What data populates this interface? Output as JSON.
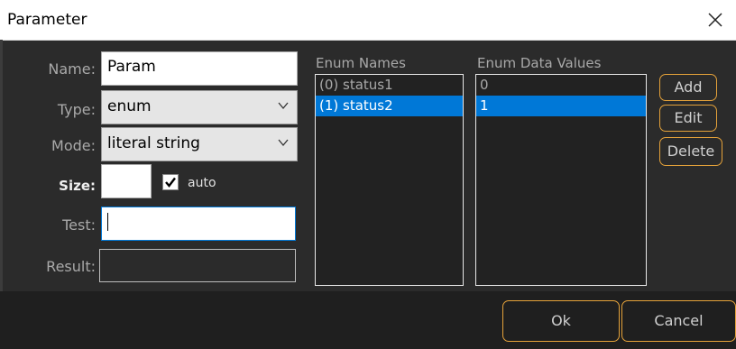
{
  "window": {
    "title": "Parameter",
    "close_icon": "close-icon"
  },
  "form": {
    "name": {
      "label": "Name:",
      "value": "Param"
    },
    "type": {
      "label": "Type:",
      "value": "enum"
    },
    "mode": {
      "label": "Mode:",
      "value": "literal string"
    },
    "size": {
      "label": "Size:",
      "value": "",
      "auto_label": "auto",
      "auto_checked": true
    },
    "test": {
      "label": "Test:",
      "value": ""
    },
    "result": {
      "label": "Result:",
      "value": ""
    }
  },
  "enum_names": {
    "header": "Enum Names",
    "items": [
      {
        "label": "(0) status1"
      },
      {
        "label": "(1) status2"
      }
    ],
    "selected_index": 1
  },
  "enum_values": {
    "header": "Enum Data Values",
    "items": [
      {
        "label": "0"
      },
      {
        "label": "1"
      }
    ],
    "selected_index": 1
  },
  "buttons": {
    "add": "Add",
    "edit": "Edit",
    "delete": "Delete",
    "ok": "Ok",
    "cancel": "Cancel"
  },
  "colors": {
    "accent_border": "#e5a23a",
    "selection": "#0078d7",
    "background": "#2b2b2b"
  }
}
